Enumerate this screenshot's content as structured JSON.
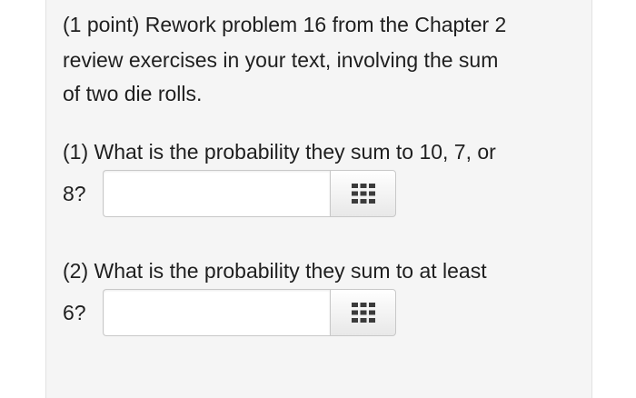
{
  "intro": {
    "line1": "(1 point) Rework problem 16 from the Chapter 2",
    "line2": "review exercises in your text, involving the sum",
    "line3": "of two die rolls."
  },
  "question1": {
    "line1": "(1) What is the probability they sum to 10, 7, or",
    "line2": "8?",
    "input_value": "",
    "button_icon": "equation-editor-grid-icon"
  },
  "question2": {
    "line1": "(2) What is the probability they sum to at least",
    "line2": "6?",
    "input_value": "",
    "button_icon": "equation-editor-grid-icon"
  }
}
